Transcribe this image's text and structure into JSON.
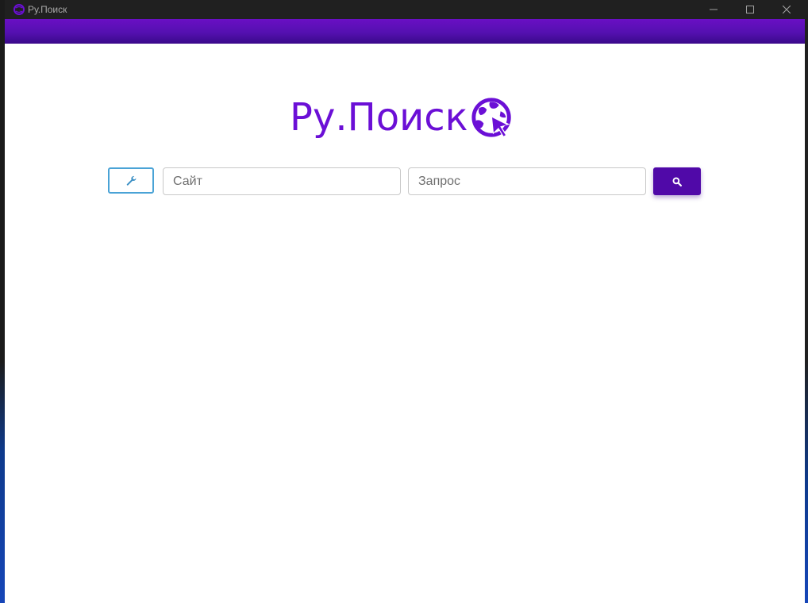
{
  "window": {
    "title": "Ру.Поиск",
    "controls": [
      "minimize-icon",
      "maximize-icon",
      "close-icon"
    ]
  },
  "header_bar": {
    "color": "#5410b0"
  },
  "logo": {
    "text": "Ру.Поиск",
    "icon": "globe-cursor-icon",
    "color": "#6b0fd6"
  },
  "search": {
    "settings_icon": "wrench-icon",
    "site_placeholder": "Сайт",
    "site_value": "",
    "query_placeholder": "Запрос",
    "query_value": "",
    "submit_icon": "search-icon"
  },
  "colors": {
    "accent": "#6b0fd6",
    "button": "#5009a8",
    "settings_border": "#4aa3d6"
  }
}
